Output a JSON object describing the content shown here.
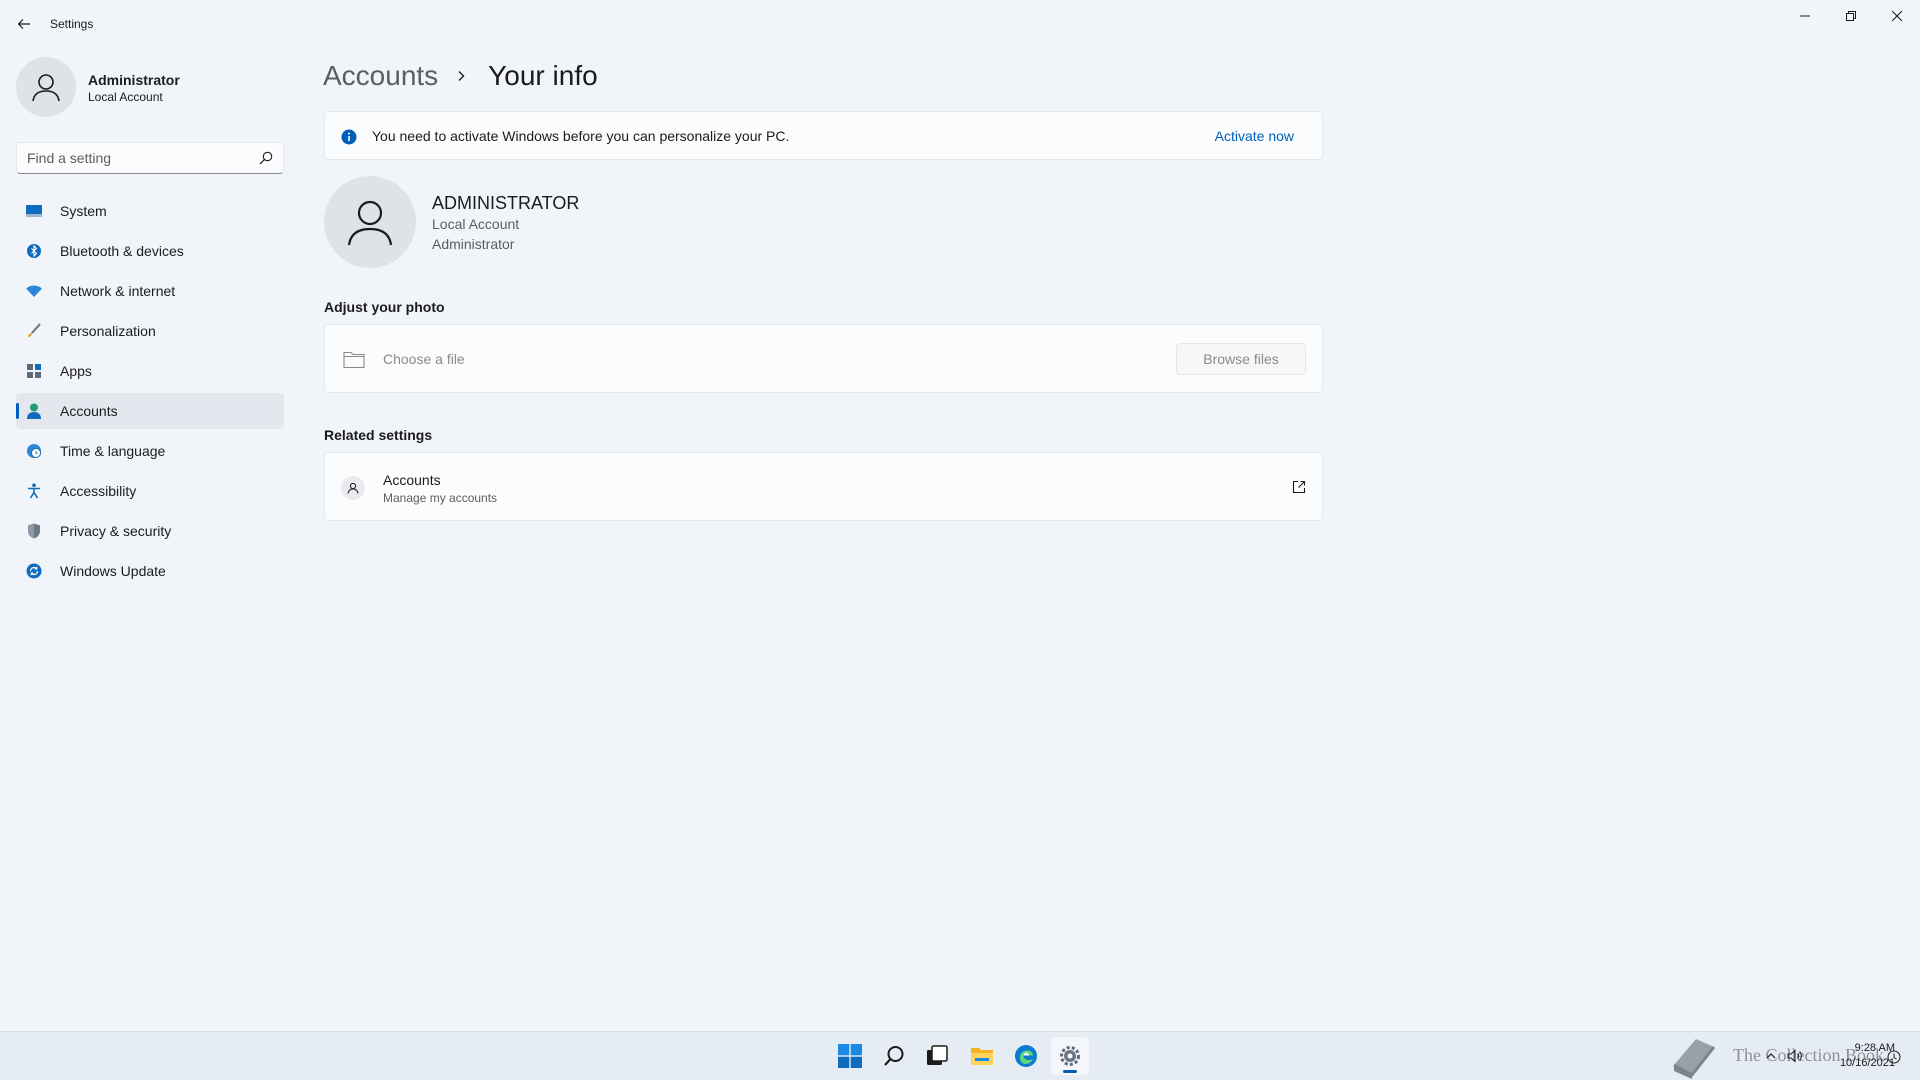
{
  "titlebar": {
    "app_title": "Settings"
  },
  "profile": {
    "name": "Administrator",
    "account_type": "Local Account"
  },
  "search": {
    "placeholder": "Find a setting"
  },
  "sidebar": {
    "items": [
      {
        "label": "System",
        "icon": "system-icon"
      },
      {
        "label": "Bluetooth & devices",
        "icon": "bluetooth-icon"
      },
      {
        "label": "Network & internet",
        "icon": "wifi-icon"
      },
      {
        "label": "Personalization",
        "icon": "brush-icon"
      },
      {
        "label": "Apps",
        "icon": "apps-icon"
      },
      {
        "label": "Accounts",
        "icon": "person-icon",
        "active": true
      },
      {
        "label": "Time & language",
        "icon": "globe-clock-icon"
      },
      {
        "label": "Accessibility",
        "icon": "accessibility-icon"
      },
      {
        "label": "Privacy & security",
        "icon": "shield-icon"
      },
      {
        "label": "Windows Update",
        "icon": "update-icon"
      }
    ]
  },
  "breadcrumb": {
    "parent": "Accounts",
    "current": "Your info"
  },
  "banner": {
    "text": "You need to activate Windows before you can personalize your PC.",
    "link": "Activate now"
  },
  "user": {
    "name": "ADMINISTRATOR",
    "line1": "Local Account",
    "line2": "Administrator"
  },
  "photo": {
    "section_title": "Adjust your photo",
    "choose_label": "Choose a file",
    "browse_label": "Browse files"
  },
  "related": {
    "section_title": "Related settings",
    "title": "Accounts",
    "subtitle": "Manage my accounts"
  },
  "taskbar": {
    "apps": [
      "start-icon",
      "search-icon",
      "task-view-icon",
      "file-explorer-icon",
      "edge-icon",
      "settings-icon"
    ],
    "time": "9:28 AM",
    "date": "10/16/2021"
  },
  "watermark": {
    "text": "The Collection Book"
  },
  "colors": {
    "accent": "#005fb8",
    "background": "#f1f5fa",
    "card": "#fbfcfd"
  }
}
